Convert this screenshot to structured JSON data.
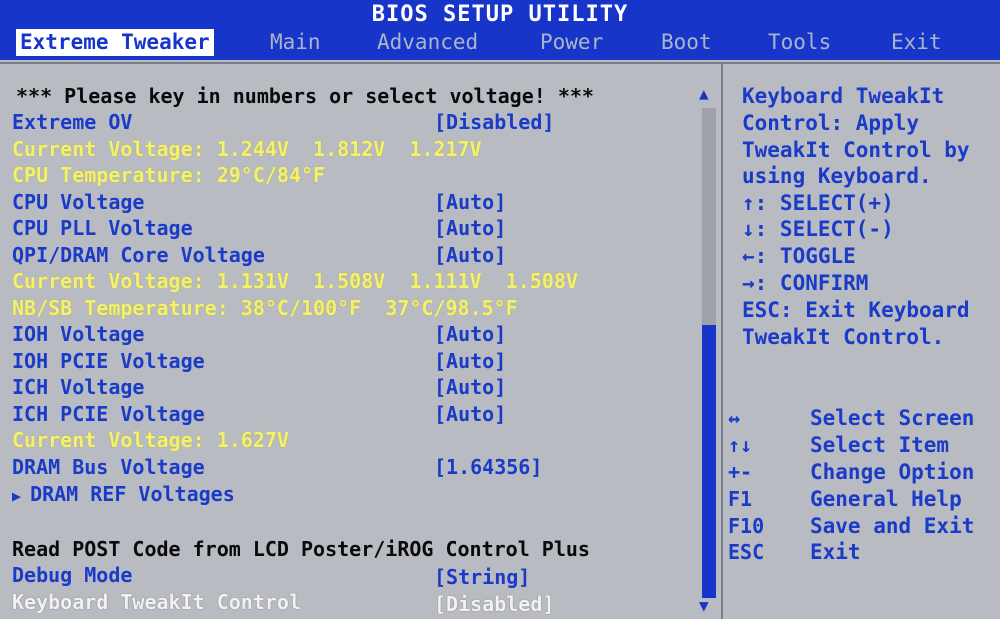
{
  "title": "BIOS SETUP UTILITY",
  "tabs": [
    "Extreme Tweaker",
    "Main",
    "Advanced",
    "Power",
    "Boot",
    "Tools",
    "Exit"
  ],
  "active_tab": "Extreme Tweaker",
  "main": {
    "notice": "*** Please key in numbers or select voltage! ***",
    "extreme_ov": {
      "label": "Extreme OV",
      "value": "[Disabled]"
    },
    "current_voltage_1": "Current Voltage: 1.244V  1.812V  1.217V",
    "cpu_temperature": "CPU Temperature: 29°C/84°F",
    "cpu_voltage": {
      "label": "CPU Voltage",
      "value": "[Auto]"
    },
    "cpu_pll_voltage": {
      "label": "CPU PLL Voltage",
      "value": "[Auto]"
    },
    "qpi_dram_voltage": {
      "label": "QPI/DRAM Core Voltage",
      "value": "[Auto]"
    },
    "current_voltage_2": "Current Voltage: 1.131V  1.508V  1.111V  1.508V",
    "nbsb_temperature": "NB/SB Temperature: 38°C/100°F  37°C/98.5°F",
    "ioh_voltage": {
      "label": "IOH Voltage",
      "value": "[Auto]"
    },
    "ioh_pcie_voltage": {
      "label": "IOH PCIE Voltage",
      "value": "[Auto]"
    },
    "ich_voltage": {
      "label": "ICH Voltage",
      "value": "[Auto]"
    },
    "ich_pcie_voltage": {
      "label": "ICH PCIE Voltage",
      "value": "[Auto]"
    },
    "current_voltage_3": "Current Voltage: 1.627V",
    "dram_bus_voltage": {
      "label": "DRAM Bus Voltage",
      "value": "[1.64356]"
    },
    "dram_ref_voltages": "DRAM REF Voltages",
    "read_post_code": "Read POST Code from LCD Poster/iROG Control Plus",
    "debug_mode": {
      "label": "Debug Mode",
      "value": "[String]"
    },
    "keyboard_tweakit": {
      "label": "Keyboard TweakIt Control",
      "value": "[Disabled]"
    }
  },
  "help": {
    "lines": [
      "Keyboard TweakIt",
      "Control: Apply",
      "TweakIt Control by",
      "using Keyboard.",
      "↑: SELECT(+)",
      "↓: SELECT(-)",
      "←: TOGGLE",
      "→: CONFIRM",
      "ESC: Exit Keyboard",
      "TweakIt Control."
    ],
    "keys": [
      {
        "key": "↔",
        "desc": "Select Screen"
      },
      {
        "key": "↑↓",
        "desc": "Select Item"
      },
      {
        "key": "+-",
        "desc": "Change Option"
      },
      {
        "key": "F1",
        "desc": "General Help"
      },
      {
        "key": "F10",
        "desc": "Save and Exit"
      },
      {
        "key": "ESC",
        "desc": "Exit"
      }
    ]
  },
  "colors": {
    "header_blue": "#1736c9",
    "panel_grey": "#b9bbc2",
    "item_blue": "#1a3bc8",
    "info_yellow": "#f4f16a"
  }
}
